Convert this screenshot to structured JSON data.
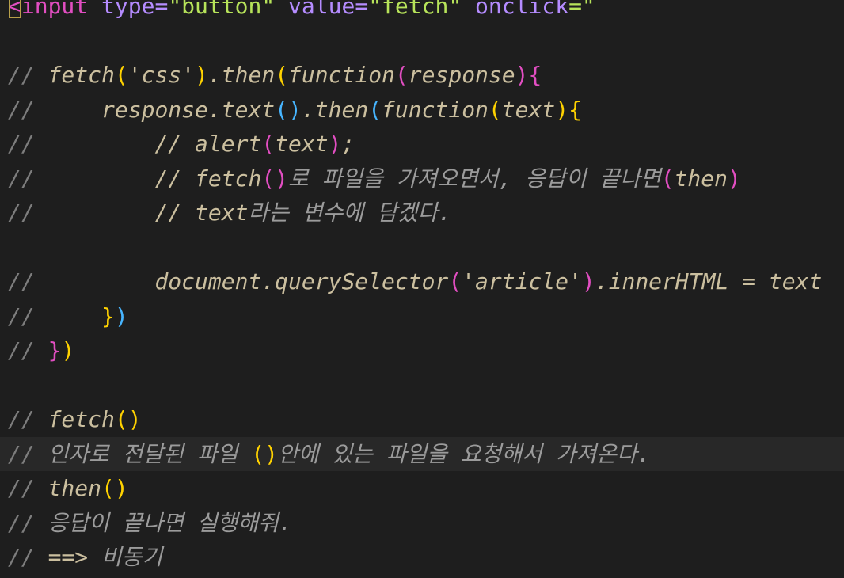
{
  "editor": {
    "lines": [
      {
        "tokens": [
          {
            "t": "<",
            "c": "tag",
            "cursor": true
          },
          {
            "t": "input ",
            "c": "tag"
          },
          {
            "t": "type",
            "c": "attr"
          },
          {
            "t": "=",
            "c": "attr"
          },
          {
            "t": "\"button\" ",
            "c": "val"
          },
          {
            "t": "value",
            "c": "attr"
          },
          {
            "t": "=",
            "c": "attr"
          },
          {
            "t": "\"fetch\" ",
            "c": "val"
          },
          {
            "t": "onclick",
            "c": "attr"
          },
          {
            "t": "=\"",
            "c": "val"
          }
        ]
      },
      {
        "tokens": []
      },
      {
        "tokens": [
          {
            "t": "// ",
            "c": "cm"
          },
          {
            "t": "fetch",
            "c": "id"
          },
          {
            "t": "(",
            "c": "p1"
          },
          {
            "t": "'css'",
            "c": "str"
          },
          {
            "t": ")",
            "c": "p1"
          },
          {
            "t": ".then",
            "c": "id"
          },
          {
            "t": "(",
            "c": "p1"
          },
          {
            "t": "function",
            "c": "kw"
          },
          {
            "t": "(",
            "c": "p2"
          },
          {
            "t": "response",
            "c": "id"
          },
          {
            "t": ")",
            "c": "p2"
          },
          {
            "t": "{",
            "c": "p2"
          }
        ]
      },
      {
        "tokens": [
          {
            "t": "//     ",
            "c": "cm"
          },
          {
            "t": "response.text",
            "c": "id"
          },
          {
            "t": "()",
            "c": "p3"
          },
          {
            "t": ".then",
            "c": "id"
          },
          {
            "t": "(",
            "c": "p3"
          },
          {
            "t": "function",
            "c": "kw"
          },
          {
            "t": "(",
            "c": "p1"
          },
          {
            "t": "text",
            "c": "id"
          },
          {
            "t": ")",
            "c": "p1"
          },
          {
            "t": "{",
            "c": "p1"
          }
        ]
      },
      {
        "tokens": [
          {
            "t": "//         ",
            "c": "cm"
          },
          {
            "t": "// alert",
            "c": "id"
          },
          {
            "t": "(",
            "c": "p2"
          },
          {
            "t": "text",
            "c": "id"
          },
          {
            "t": ")",
            "c": "p2"
          },
          {
            "t": ";",
            "c": "id"
          }
        ]
      },
      {
        "tokens": [
          {
            "t": "//         ",
            "c": "cm"
          },
          {
            "t": "// fetch",
            "c": "id"
          },
          {
            "t": "()",
            "c": "p2"
          },
          {
            "t": "로 파일을 가져오면서, 응답이 끝나면",
            "c": "cc"
          },
          {
            "t": "(",
            "c": "p2"
          },
          {
            "t": "then",
            "c": "id"
          },
          {
            "t": ")",
            "c": "p2"
          }
        ]
      },
      {
        "tokens": [
          {
            "t": "//         ",
            "c": "cm"
          },
          {
            "t": "// text",
            "c": "id"
          },
          {
            "t": "라는 변수에 담겠다.",
            "c": "cc"
          }
        ]
      },
      {
        "tokens": []
      },
      {
        "tokens": [
          {
            "t": "//         ",
            "c": "cm"
          },
          {
            "t": "document.querySelector",
            "c": "id"
          },
          {
            "t": "(",
            "c": "p2"
          },
          {
            "t": "'article'",
            "c": "str"
          },
          {
            "t": ")",
            "c": "p2"
          },
          {
            "t": ".innerHTML = text",
            "c": "id"
          }
        ]
      },
      {
        "tokens": [
          {
            "t": "//     ",
            "c": "cm"
          },
          {
            "t": "}",
            "c": "p1"
          },
          {
            "t": ")",
            "c": "p3"
          }
        ]
      },
      {
        "tokens": [
          {
            "t": "// ",
            "c": "cm"
          },
          {
            "t": "}",
            "c": "p2"
          },
          {
            "t": ")",
            "c": "p1"
          }
        ]
      },
      {
        "tokens": []
      },
      {
        "tokens": [
          {
            "t": "// ",
            "c": "cm"
          },
          {
            "t": "fetch",
            "c": "id"
          },
          {
            "t": "()",
            "c": "p1"
          }
        ]
      },
      {
        "active": true,
        "tokens": [
          {
            "t": "// ",
            "c": "cm"
          },
          {
            "t": "인자로 전달된 파일 ",
            "c": "cc"
          },
          {
            "t": "()",
            "c": "p1"
          },
          {
            "t": "안에 있는 파일을 요청해서 가져온다.",
            "c": "cc"
          }
        ]
      },
      {
        "tokens": [
          {
            "t": "// ",
            "c": "cm"
          },
          {
            "t": "then",
            "c": "id"
          },
          {
            "t": "()",
            "c": "p1"
          }
        ]
      },
      {
        "tokens": [
          {
            "t": "// ",
            "c": "cm"
          },
          {
            "t": "응답이 끝나면 실행해줘.",
            "c": "cc"
          }
        ]
      },
      {
        "tokens": [
          {
            "t": "// ",
            "c": "cm"
          },
          {
            "t": "==> ",
            "c": "id"
          },
          {
            "t": "비동기",
            "c": "cc"
          }
        ]
      }
    ]
  }
}
